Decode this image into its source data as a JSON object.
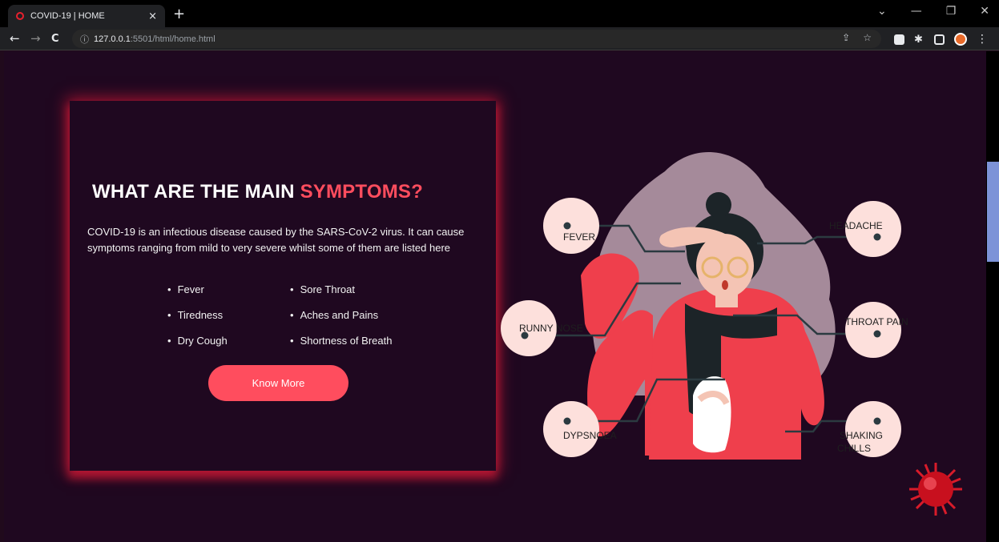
{
  "browser": {
    "tab_title": "COVID-19 | HOME",
    "tab_close": "×",
    "new_tab": "+",
    "url_host": "127.0.0.1",
    "url_rest": ":5501/html/home.html",
    "controls": {
      "minimize": "—",
      "restore": "❐",
      "close": "✕",
      "chevron": "⌄"
    },
    "nav": {
      "back": "←",
      "forward": "→",
      "reload": "C"
    }
  },
  "page": {
    "heading_main": "WHAT ARE THE MAIN ",
    "heading_accent": "SYMPTOMS?",
    "intro": "COVID-19 is an infectious disease caused by the SARS-CoV-2 virus. It can cause symptoms ranging from mild to very severe whilst some of them are listed here",
    "symptoms": [
      "Fever",
      "Sore Throat",
      "Tiredness",
      "Aches and Pains",
      "Dry Cough",
      "Shortness of Breath"
    ],
    "button_label": "Know More"
  },
  "illustration": {
    "labels": {
      "fever": "FEVER",
      "headache": "HEADACHE",
      "runny_nose": "RUNNY NOSE",
      "throat_pain": "THROAT PAIN",
      "dypsnoea": "DYPSNOEA",
      "shaking": "SHAKING",
      "chills": "CHILLS"
    }
  },
  "colors": {
    "accent": "#ff4d5e",
    "background": "#1f0820",
    "bubble": "#fde0dc",
    "sweater": "#ef3f4c"
  }
}
